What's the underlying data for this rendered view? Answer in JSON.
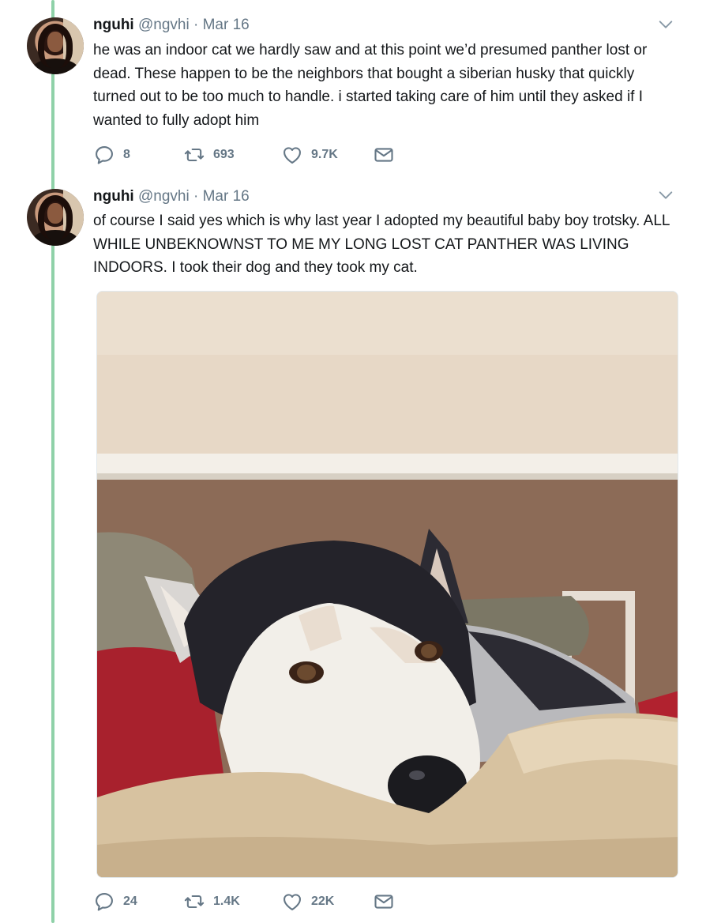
{
  "tweets": [
    {
      "name": "nguhi",
      "handle": "@ngvhi",
      "separator": "·",
      "date": "Mar 16",
      "text": "he was an indoor cat we hardly saw and at this point we’d presumed panther lost or dead. These happen to be the neighbors that bought a siberian husky that quickly turned out to be too much to handle. i started taking care of him until they asked if I wanted to fully adopt him",
      "actions": {
        "replies": "8",
        "retweets": "693",
        "likes": "9.7K"
      }
    },
    {
      "name": "nguhi",
      "handle": "@ngvhi",
      "separator": "·",
      "date": "Mar 16",
      "text": "of course I said yes which is why last year I adopted my beautiful baby boy trotsky. ALL WHILE UNBEKNOWNST TO ME MY LONG LOST CAT PANTHER WAS LIVING INDOORS. I took their dog and they took my cat.",
      "actions": {
        "replies": "24",
        "retweets": "1.4K",
        "likes": "22K"
      }
    }
  ],
  "icons": {
    "reply": "reply-icon",
    "retweet": "retweet-icon",
    "like": "heart-icon",
    "message": "envelope-icon",
    "menu": "chevron-down-icon"
  },
  "colors": {
    "thread_line": "#8fd1a8",
    "secondary_text": "#657786",
    "primary_text": "#14171a"
  }
}
